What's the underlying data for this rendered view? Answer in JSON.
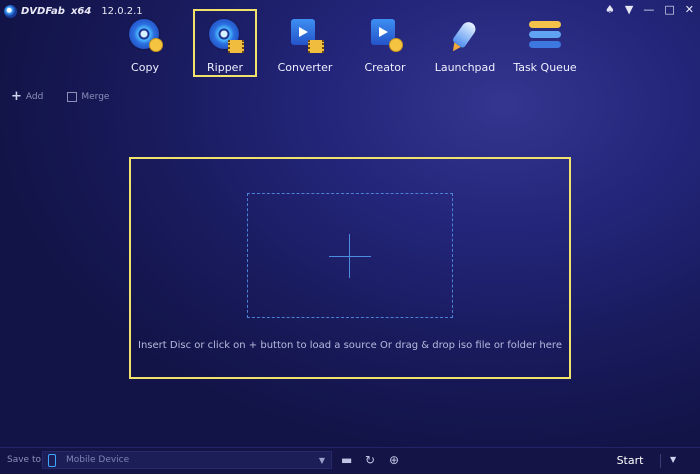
{
  "app": {
    "brand": "DVDFab",
    "arch": "x64",
    "version": "12.0.2.1",
    "window_controls": {
      "skin": "♠",
      "menu": "▼",
      "minimize": "—",
      "maximize": "□",
      "close": "✕"
    }
  },
  "modules": [
    {
      "label": "Copy",
      "icon": "copy-disc-icon"
    },
    {
      "label": "Ripper",
      "icon": "ripper-disc-film-icon",
      "active": true
    },
    {
      "label": "Converter",
      "icon": "converter-film-icon"
    },
    {
      "label": "Creator",
      "icon": "creator-film-disc-icon"
    },
    {
      "label": "Launchpad",
      "icon": "launchpad-rocket-icon"
    },
    {
      "label": "Task Queue",
      "icon": "task-queue-stack-icon"
    }
  ],
  "actions": {
    "add": "Add",
    "merge": "Merge"
  },
  "drop_area": {
    "hint": "Insert Disc or click on + button to load a source Or drag & drop iso file or folder here"
  },
  "bottom": {
    "save_to_label": "Save to:",
    "save_to_value": "Mobile Device",
    "start": "Start"
  },
  "colors": {
    "highlight": "#f0e26a",
    "accent": "#4c8de0",
    "background": "#1c1e62"
  }
}
